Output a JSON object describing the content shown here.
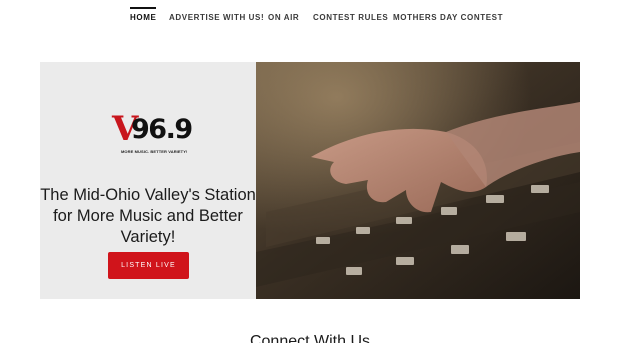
{
  "nav": {
    "items": [
      {
        "label": "HOME",
        "active": true
      },
      {
        "label": "ADVERTISE WITH US!"
      },
      {
        "label": "ON AIR"
      },
      {
        "label": "CONTEST RULES"
      },
      {
        "label": "MOTHERS DAY CONTEST"
      }
    ]
  },
  "hero": {
    "logo": {
      "letter": "V",
      "frequency": "96.9",
      "tagline": "MORE MUSIC. BETTER VARIETY!"
    },
    "headline": "The Mid-Ohio Valley's Station for More Music and Better Variety!",
    "cta_label": "LISTEN LIVE",
    "image_subject": "hand-on-mixing-console-photo"
  },
  "section": {
    "title": "Connect With Us"
  },
  "colors": {
    "accent": "#d0141b",
    "panel_bg": "#ebebeb",
    "text": "#1b1b1b"
  }
}
